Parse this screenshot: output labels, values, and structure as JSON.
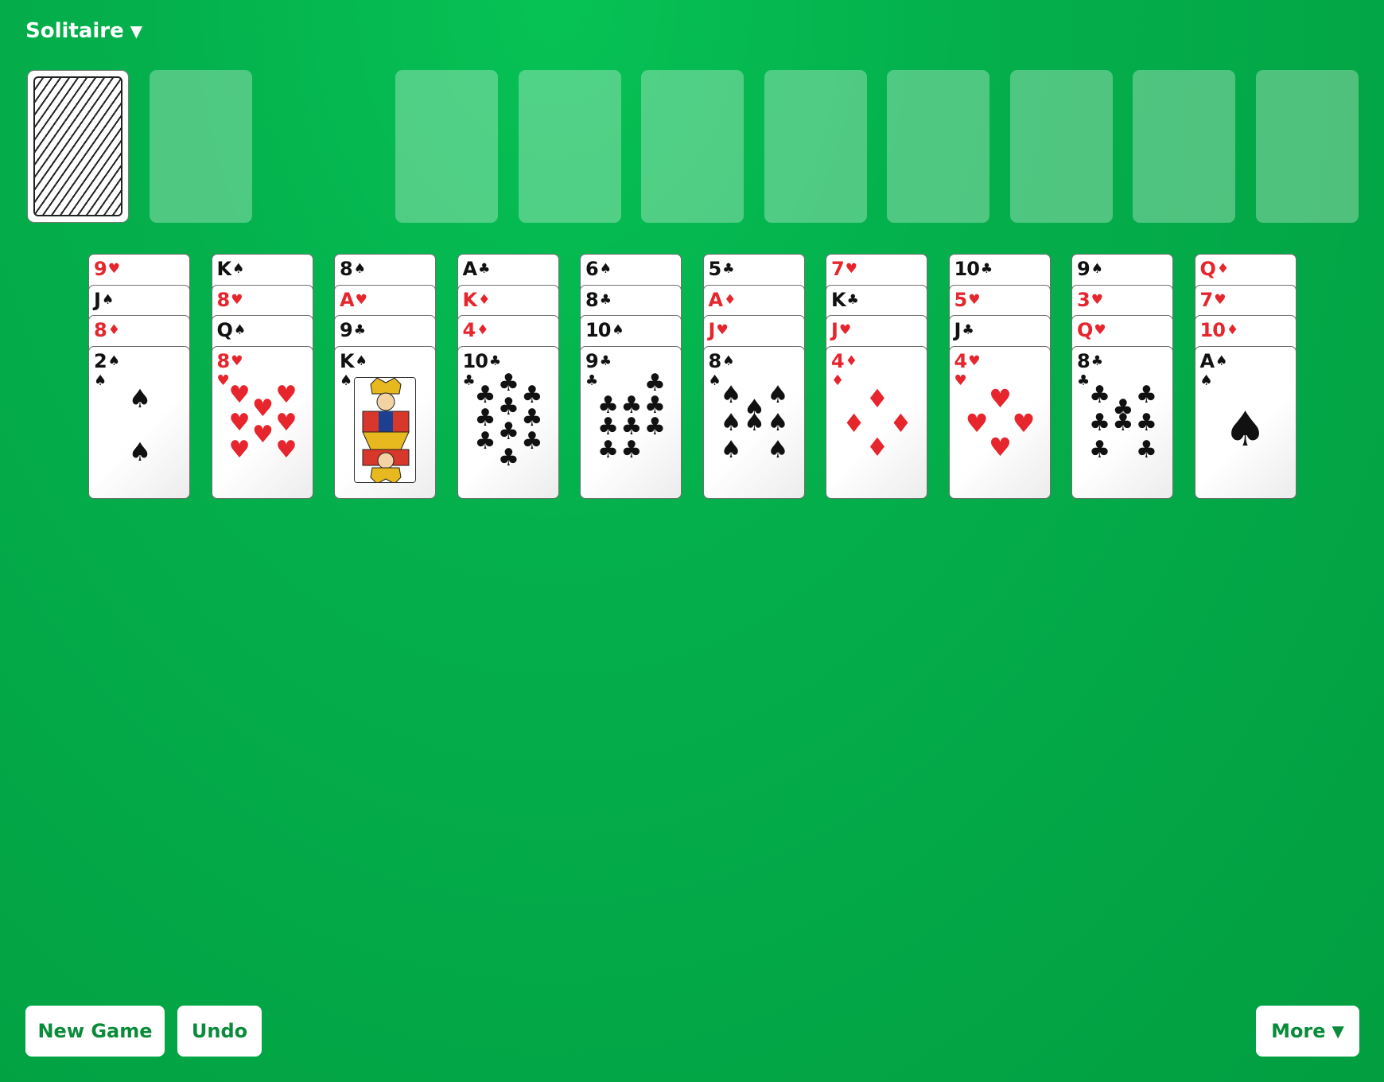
{
  "app": {
    "title": "Solitaire"
  },
  "buttons": {
    "new_game": "New Game",
    "undo": "Undo",
    "more": "More"
  },
  "colors": {
    "table": "#04b04c",
    "button_text": "#0a8b3a",
    "red_suit": "#e6252d",
    "black_suit": "#111111"
  },
  "foundations": {
    "empty_slots": 8
  },
  "waste": {
    "empty": true
  },
  "tableau": [
    {
      "covered": [
        {
          "rank": "9",
          "suit": "hearts"
        },
        {
          "rank": "J",
          "suit": "spades"
        },
        {
          "rank": "8",
          "suit": "diamonds"
        }
      ],
      "top": {
        "rank": "2",
        "suit": "spades"
      }
    },
    {
      "covered": [
        {
          "rank": "K",
          "suit": "spades"
        },
        {
          "rank": "8",
          "suit": "hearts"
        },
        {
          "rank": "Q",
          "suit": "spades"
        }
      ],
      "top": {
        "rank": "8",
        "suit": "hearts"
      }
    },
    {
      "covered": [
        {
          "rank": "8",
          "suit": "spades"
        },
        {
          "rank": "A",
          "suit": "hearts"
        },
        {
          "rank": "9",
          "suit": "clubs"
        }
      ],
      "top": {
        "rank": "K",
        "suit": "spades"
      }
    },
    {
      "covered": [
        {
          "rank": "A",
          "suit": "clubs"
        },
        {
          "rank": "K",
          "suit": "diamonds"
        },
        {
          "rank": "4",
          "suit": "diamonds"
        }
      ],
      "top": {
        "rank": "10",
        "suit": "clubs"
      }
    },
    {
      "covered": [
        {
          "rank": "6",
          "suit": "spades"
        },
        {
          "rank": "8",
          "suit": "clubs"
        },
        {
          "rank": "10",
          "suit": "spades"
        }
      ],
      "top": {
        "rank": "9",
        "suit": "clubs"
      }
    },
    {
      "covered": [
        {
          "rank": "5",
          "suit": "clubs"
        },
        {
          "rank": "A",
          "suit": "diamonds"
        },
        {
          "rank": "J",
          "suit": "hearts"
        }
      ],
      "top": {
        "rank": "8",
        "suit": "spades"
      }
    },
    {
      "covered": [
        {
          "rank": "7",
          "suit": "hearts"
        },
        {
          "rank": "K",
          "suit": "clubs"
        },
        {
          "rank": "J",
          "suit": "hearts"
        }
      ],
      "top": {
        "rank": "4",
        "suit": "diamonds"
      }
    },
    {
      "covered": [
        {
          "rank": "10",
          "suit": "clubs"
        },
        {
          "rank": "5",
          "suit": "hearts"
        },
        {
          "rank": "J",
          "suit": "clubs"
        }
      ],
      "top": {
        "rank": "4",
        "suit": "hearts"
      }
    },
    {
      "covered": [
        {
          "rank": "9",
          "suit": "spades"
        },
        {
          "rank": "3",
          "suit": "hearts"
        },
        {
          "rank": "Q",
          "suit": "hearts"
        }
      ],
      "top": {
        "rank": "8",
        "suit": "clubs"
      }
    },
    {
      "covered": [
        {
          "rank": "Q",
          "suit": "diamonds"
        },
        {
          "rank": "7",
          "suit": "hearts"
        },
        {
          "rank": "10",
          "suit": "diamonds"
        }
      ],
      "top": {
        "rank": "A",
        "suit": "spades"
      }
    }
  ]
}
